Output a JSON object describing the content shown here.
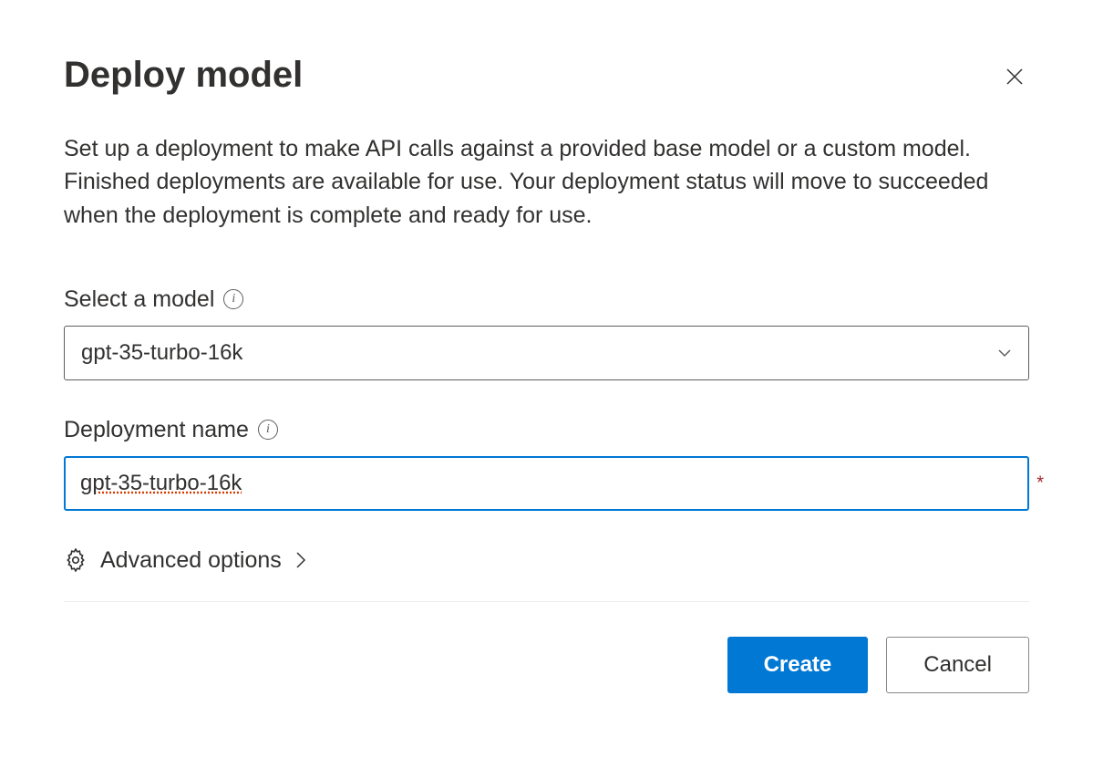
{
  "dialog": {
    "title": "Deploy model",
    "description": "Set up a deployment to make API calls against a provided base model or a custom model. Finished deployments are available for use. Your deployment status will move to succeeded when the deployment is complete and ready for use."
  },
  "fields": {
    "model": {
      "label": "Select a model",
      "value": "gpt-35-turbo-16k"
    },
    "deployment_name": {
      "label": "Deployment name",
      "value": "gpt-35-turbo-16k"
    }
  },
  "advanced": {
    "label": "Advanced options"
  },
  "buttons": {
    "create": "Create",
    "cancel": "Cancel"
  }
}
